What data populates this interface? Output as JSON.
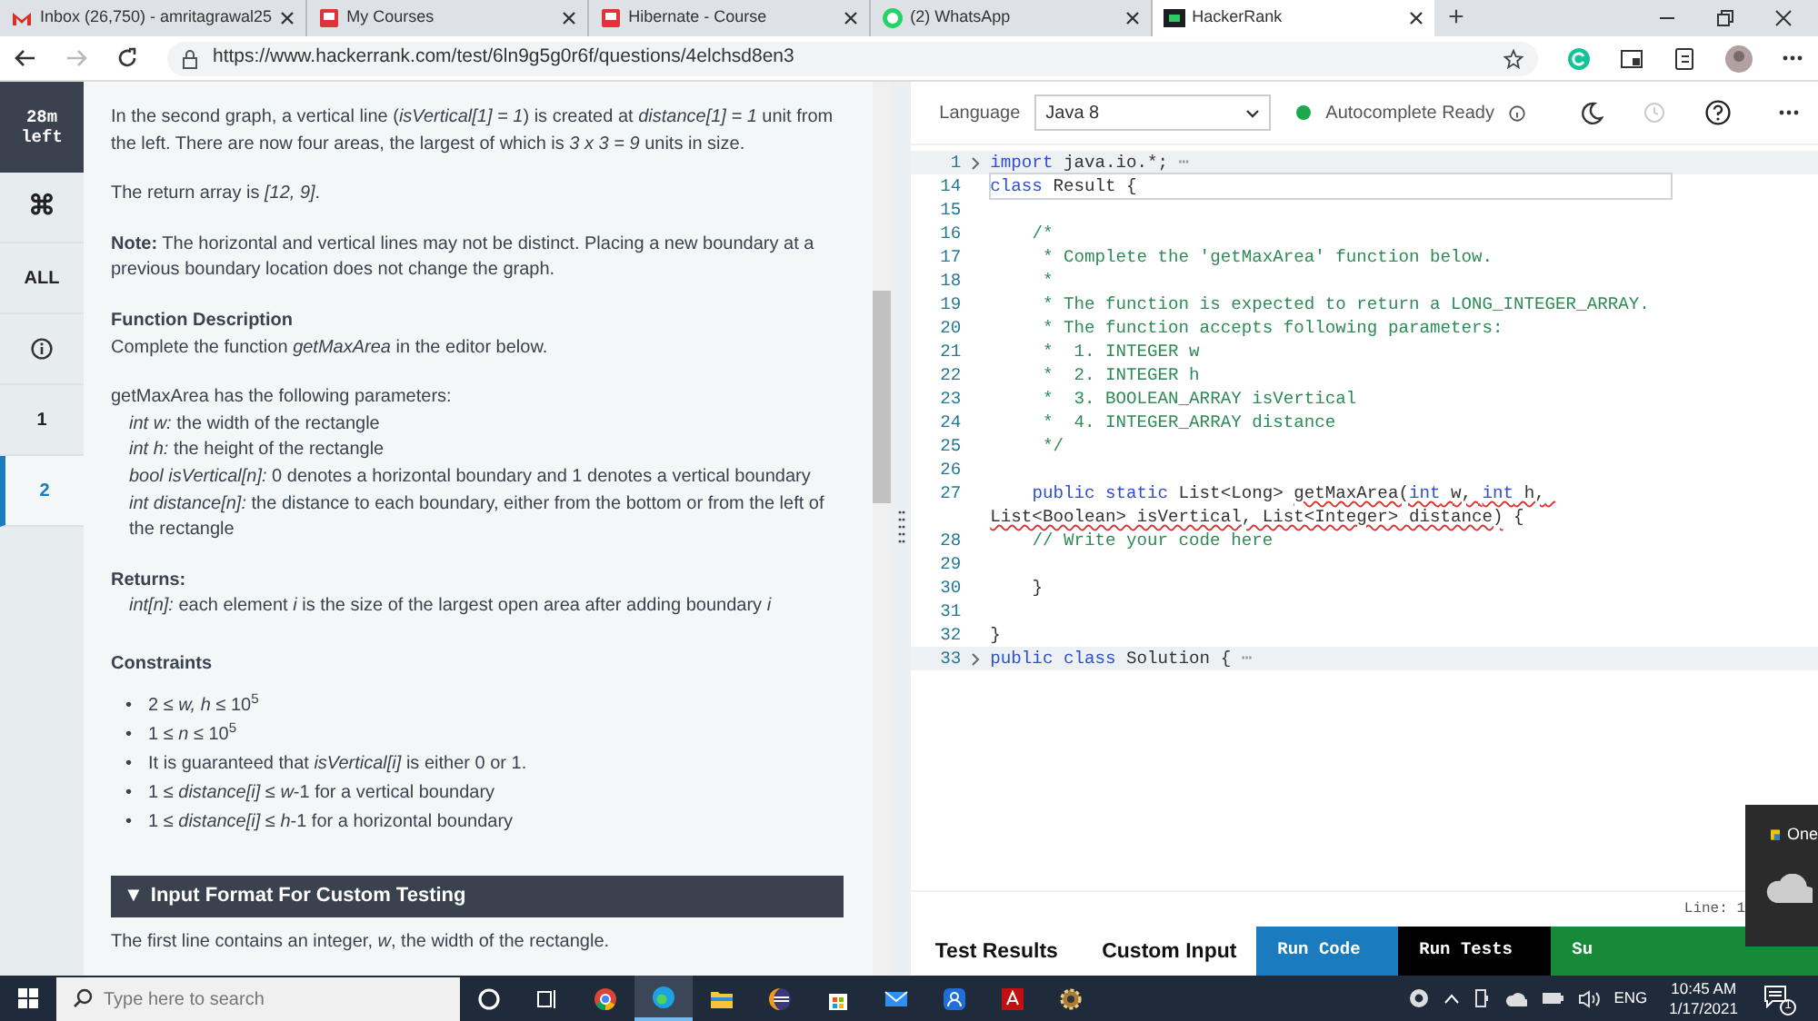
{
  "browser": {
    "tabs": [
      {
        "title": "Inbox (26,750) - amritagrawal25",
        "kind": "mail",
        "selected": false
      },
      {
        "title": "My Courses",
        "kind": "book",
        "selected": false
      },
      {
        "title": "Hibernate - Course",
        "kind": "book",
        "selected": false
      },
      {
        "title": "(2) WhatsApp",
        "kind": "chat",
        "selected": false
      },
      {
        "title": "HackerRank",
        "kind": "hr",
        "selected": true
      }
    ],
    "new_tab": "+",
    "url": "https://www.hackerrank.com/test/6ln9g5g0r6f/questions/4elchsd8en3"
  },
  "sidebar": {
    "timer": "28m left",
    "items": [
      {
        "kind": "text",
        "label": "⌘",
        "selected": false
      },
      {
        "kind": "text",
        "label": "ALL",
        "selected": false
      },
      {
        "kind": "info",
        "selected": false
      },
      {
        "kind": "text",
        "label": "1",
        "selected": false
      },
      {
        "kind": "text",
        "label": "2",
        "selected": true
      }
    ]
  },
  "problem": {
    "blocks": [
      {
        "kind": "para",
        "text": "In the second graph, a vertical line (*isVertical[1] = 1*) is created at *distance[1] = 1* unit from the left. There are now four areas, the largest of which is *3 x 3 = 9* units in size."
      },
      {
        "kind": "para",
        "text": "The return array is *[12, 9]*."
      },
      {
        "kind": "para",
        "text": "**Note:** The horizontal and vertical lines may not be distinct. Placing a new boundary at a previous boundary location does not change the graph."
      },
      {
        "kind": "section",
        "title": "Function Description",
        "lines": [
          {
            "kind": "plain",
            "text": "Complete the function *getMaxArea* in the editor below."
          }
        ]
      },
      {
        "kind": "section",
        "lines": [
          {
            "kind": "plain",
            "text": "getMaxArea has the following parameters:"
          },
          {
            "kind": "param",
            "text": "*int w:* the width of the rectangle"
          },
          {
            "kind": "param",
            "text": "*int h:* the height of the rectangle"
          },
          {
            "kind": "param",
            "text": "*bool isVertical[n]:* 0 denotes a horizontal boundary and 1 denotes a vertical boundary"
          },
          {
            "kind": "param",
            "text": "*int distance[n]:*  the distance to each boundary, either from the bottom or from the left of the rectangle"
          }
        ]
      },
      {
        "kind": "section",
        "title": "Returns:",
        "lines": [
          {
            "kind": "param",
            "text": "*int[n]:* each element *i* is the size of the largest open area after adding boundary *i*"
          }
        ]
      },
      {
        "kind": "list",
        "title": "Constraints",
        "bullet": "•",
        "items": [
          "2 *≤ w, h ≤* 10$^{5}$",
          "1 *≤ n ≤* 10$^{5}$",
          " It is guaranteed that *isVertical[i]* is either 0 or 1.",
          "1 *≤ distance[i] ≤ w*-1 for a vertical boundary",
          "1 *≤ distance[i] ≤ h*-1 for a horizontal boundary"
        ]
      },
      {
        "kind": "collapsible",
        "marker": "▼",
        "title": "Input Format For Custom Testing",
        "expanded": true
      },
      {
        "kind": "para",
        "text": "The first line contains an integer, *w*, the width of the rectangle."
      }
    ]
  },
  "editor": {
    "language_label": "Language",
    "language": "Java 8",
    "autocomplete": "Autocomplete Ready",
    "autocomplete_ready": true,
    "lines": [
      {
        "number": "1",
        "folded": true,
        "current": false,
        "tokens": [
          {
            "t": "import",
            "kind": "keyword"
          },
          {
            "t": " java.io.*;",
            "kind": "plain"
          },
          {
            "t": " ⋯",
            "kind": "fold"
          }
        ]
      },
      {
        "number": "14",
        "folded": false,
        "current": true,
        "tokens": [
          {
            "t": "class",
            "kind": "keyword"
          },
          {
            "t": " Result {",
            "kind": "plain"
          }
        ]
      },
      {
        "number": "15",
        "folded": false,
        "current": false
      },
      {
        "number": "16",
        "folded": false,
        "current": false,
        "tokens": [
          {
            "t": "    /*",
            "kind": "comment"
          }
        ]
      },
      {
        "number": "17",
        "folded": false,
        "current": false,
        "tokens": [
          {
            "t": "     * Complete the 'getMaxArea' function below.",
            "kind": "comment"
          }
        ]
      },
      {
        "number": "18",
        "folded": false,
        "current": false,
        "tokens": [
          {
            "t": "     *",
            "kind": "comment"
          }
        ]
      },
      {
        "number": "19",
        "folded": false,
        "current": false,
        "tokens": [
          {
            "t": "     * The function is expected to return a LONG_INTEGER_ARRAY.",
            "kind": "comment"
          }
        ]
      },
      {
        "number": "20",
        "folded": false,
        "current": false,
        "tokens": [
          {
            "t": "     * The function accepts following parameters:",
            "kind": "comment"
          }
        ]
      },
      {
        "number": "21",
        "folded": false,
        "current": false,
        "tokens": [
          {
            "t": "     *  1. INTEGER w",
            "kind": "comment"
          }
        ]
      },
      {
        "number": "22",
        "folded": false,
        "current": false,
        "tokens": [
          {
            "t": "     *  2. INTEGER h",
            "kind": "comment"
          }
        ]
      },
      {
        "number": "23",
        "folded": false,
        "current": false,
        "tokens": [
          {
            "t": "     *  3. BOOLEAN_ARRAY isVertical",
            "kind": "comment"
          }
        ]
      },
      {
        "number": "24",
        "folded": false,
        "current": false,
        "tokens": [
          {
            "t": "     *  4. INTEGER_ARRAY distance",
            "kind": "comment"
          }
        ]
      },
      {
        "number": "25",
        "folded": false,
        "current": false,
        "tokens": [
          {
            "t": "     */",
            "kind": "comment"
          }
        ]
      },
      {
        "number": "26",
        "folded": false,
        "current": false
      },
      {
        "number": "27",
        "folded": false,
        "current": false,
        "tokens": [
          {
            "t": "    public static",
            "kind": "keyword"
          },
          {
            "t": " List<Long> ",
            "kind": "plain"
          },
          {
            "t": "getMaxArea(",
            "kind": "error"
          },
          {
            "t": "int",
            "kind": "error_keyword"
          },
          {
            "t": " w, ",
            "kind": "error"
          },
          {
            "t": "int",
            "kind": "error_keyword"
          },
          {
            "t": " h, List<Boolean> isVertical, List<Integer> distance)",
            "kind": "error"
          },
          {
            "t": " {",
            "kind": "plain"
          }
        ]
      },
      {
        "number": "28",
        "folded": false,
        "current": false,
        "tokens": [
          {
            "t": "    // Write your code here",
            "kind": "comment"
          }
        ]
      },
      {
        "number": "29",
        "folded": false,
        "current": false
      },
      {
        "number": "30",
        "folded": false,
        "current": false,
        "tokens": [
          {
            "t": "    }",
            "kind": "plain"
          }
        ]
      },
      {
        "number": "31",
        "folded": false,
        "current": false
      },
      {
        "number": "32",
        "folded": false,
        "current": false,
        "tokens": [
          {
            "t": "}",
            "kind": "plain"
          }
        ]
      },
      {
        "number": "33",
        "folded": true,
        "current": false,
        "tokens": [
          {
            "t": "public class",
            "kind": "keyword"
          },
          {
            "t": " Solution {",
            "kind": "plain"
          },
          {
            "t": " ⋯",
            "kind": "fold"
          }
        ]
      }
    ],
    "status": "Line: 1",
    "tabs": [
      {
        "label": "Test Results"
      },
      {
        "label": "Custom Input"
      }
    ],
    "actions": [
      {
        "label": "Run Code",
        "kind": "run"
      },
      {
        "label": "Run Tests",
        "kind": "tests"
      },
      {
        "label": "Su",
        "kind": "submit"
      }
    ]
  },
  "notification": {
    "title": "One"
  },
  "taskbar": {
    "search_placeholder": "Type here to search",
    "apps": [
      {
        "kind": "cortana",
        "selected": false
      },
      {
        "kind": "taskview",
        "selected": false
      },
      {
        "kind": "chrome",
        "selected": false
      },
      {
        "kind": "edge",
        "selected": true
      },
      {
        "kind": "files",
        "selected": false
      },
      {
        "kind": "eclipse",
        "selected": false
      },
      {
        "kind": "store",
        "selected": false
      },
      {
        "kind": "mail",
        "selected": false
      },
      {
        "kind": "people",
        "selected": false
      },
      {
        "kind": "acrobat",
        "selected": false
      },
      {
        "kind": "settings",
        "selected": false
      }
    ],
    "language": "ENG",
    "time": "10:45 AM",
    "date": "1/17/2021",
    "notifications": "1"
  }
}
